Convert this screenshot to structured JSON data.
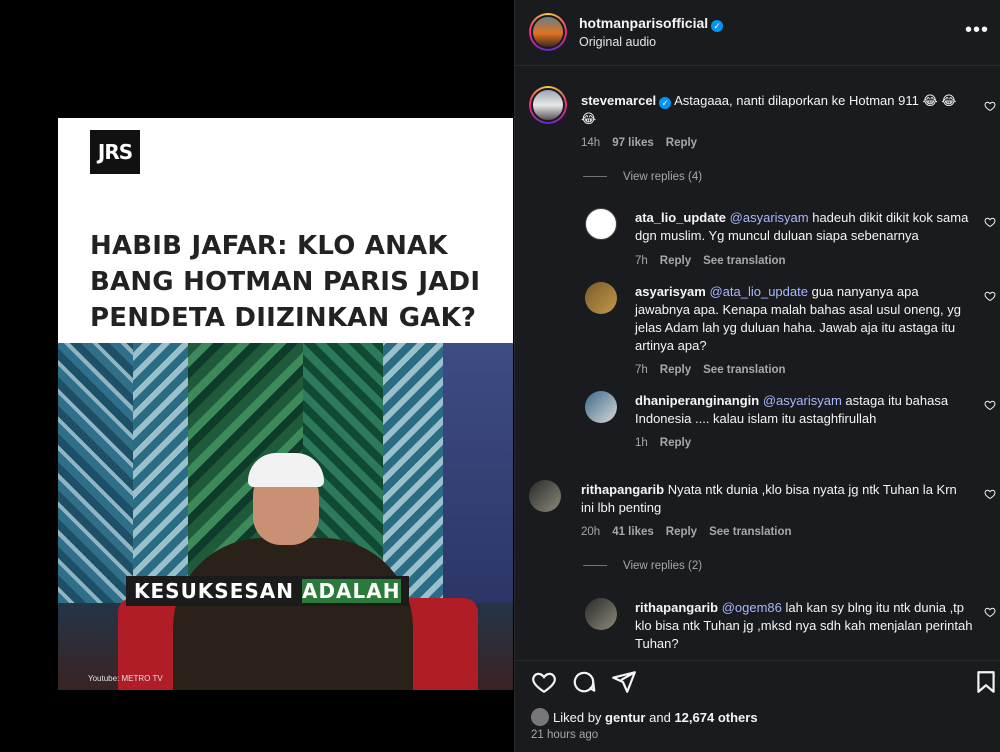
{
  "media": {
    "logo": "JRS",
    "headline": "HABIB JAFAR: KLO ANAK BANG HOTMAN PARIS JADI PENDETA DIIZINKAN GAK?",
    "subtitle_a": "KESUKSESAN",
    "subtitle_b": "ADALAH",
    "credit": "Youtube: METRO TV"
  },
  "post": {
    "author": "hotmanparisofficial",
    "audio": "Original audio",
    "more_icon": "more-horizontal-icon"
  },
  "comments": [
    {
      "user": "stevemarcel",
      "verified": true,
      "text": "Astagaaa, nanti dilaporkan ke Hotman 911 😂 😂 😂",
      "time": "14h",
      "likes": "97 likes",
      "reply": "Reply",
      "view_replies": "View replies (4)"
    },
    {
      "user": "ata_lio_update",
      "mention": "@asyarisyam",
      "text": "hadeuh dikit dikit kok sama dgn muslim. Yg muncul duluan siapa sebenarnya",
      "time": "7h",
      "reply": "Reply",
      "translate": "See translation"
    },
    {
      "user": "asyarisyam",
      "mention": "@ata_lio_update",
      "text": "gua nanyanya apa jawabnya apa. Kenapa malah bahas asal usul oneng, yg jelas Adam lah yg duluan haha. Jawab aja itu astaga itu artinya apa?",
      "time": "7h",
      "reply": "Reply",
      "translate": "See translation"
    },
    {
      "user": "dhaniperanginangin",
      "mention": "@asyarisyam",
      "text": "astaga itu bahasa Indonesia .... kalau islam itu astaghfirullah",
      "time": "1h",
      "reply": "Reply"
    },
    {
      "user": "rithapangarib",
      "text": "Nyata ntk dunia ,klo bisa nyata jg ntk Tuhan la Krn ini lbh penting",
      "time": "20h",
      "likes": "41 likes",
      "reply": "Reply",
      "translate": "See translation",
      "view_replies": "View replies (2)"
    },
    {
      "user": "rithapangarib",
      "mention": "@ogem86",
      "text": "lah kan sy blng itu ntk dunia ,tp klo bisa ntk Tuhan jg ,mksd nya sdh kah menjalan perintah Tuhan?"
    }
  ],
  "footer": {
    "liked_prefix": "Liked by",
    "liked_user": "gentur",
    "liked_and": "and",
    "liked_count": "12,674 others",
    "ago": "21 hours ago"
  },
  "icons": [
    "heart-icon",
    "comment-icon",
    "share-icon",
    "bookmark-icon"
  ],
  "colors": {
    "panel_bg": "#1a1b1e",
    "mention": "#a8b9ff",
    "verified": "#0095f6",
    "muted": "#a8a8a8"
  }
}
